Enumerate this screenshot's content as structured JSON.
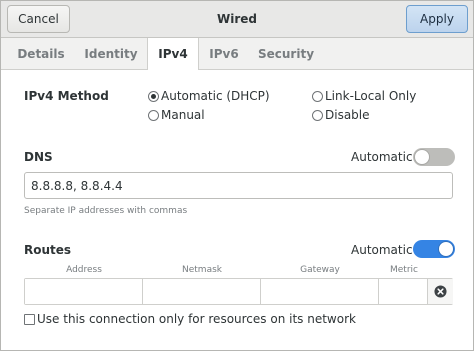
{
  "header": {
    "cancel_label": "Cancel",
    "title": "Wired",
    "apply_label": "Apply"
  },
  "tabs": [
    {
      "label": "Details",
      "active": false
    },
    {
      "label": "Identity",
      "active": false
    },
    {
      "label": "IPv4",
      "active": true
    },
    {
      "label": "IPv6",
      "active": false
    },
    {
      "label": "Security",
      "active": false
    }
  ],
  "ipv4": {
    "method_label": "IPv4 Method",
    "options": [
      {
        "label": "Automatic (DHCP)",
        "checked": true
      },
      {
        "label": "Link-Local Only",
        "checked": false
      },
      {
        "label": "Manual",
        "checked": false
      },
      {
        "label": "Disable",
        "checked": false
      }
    ]
  },
  "dns": {
    "label": "DNS",
    "automatic_label": "Automatic",
    "automatic_on": false,
    "value": "8.8.8.8, 8.8.4.4",
    "hint": "Separate IP addresses with commas"
  },
  "routes": {
    "label": "Routes",
    "automatic_label": "Automatic",
    "automatic_on": true,
    "columns": [
      "Address",
      "Netmask",
      "Gateway",
      "Metric"
    ],
    "row": {
      "address": "",
      "netmask": "",
      "gateway": "",
      "metric": ""
    }
  },
  "only_local": {
    "label": "Use this connection only for resources on its network",
    "checked": false
  },
  "colors": {
    "accent": "#3584e4",
    "apply_bg": "#bcd3ed",
    "toggle_off": "#bdbdba"
  }
}
